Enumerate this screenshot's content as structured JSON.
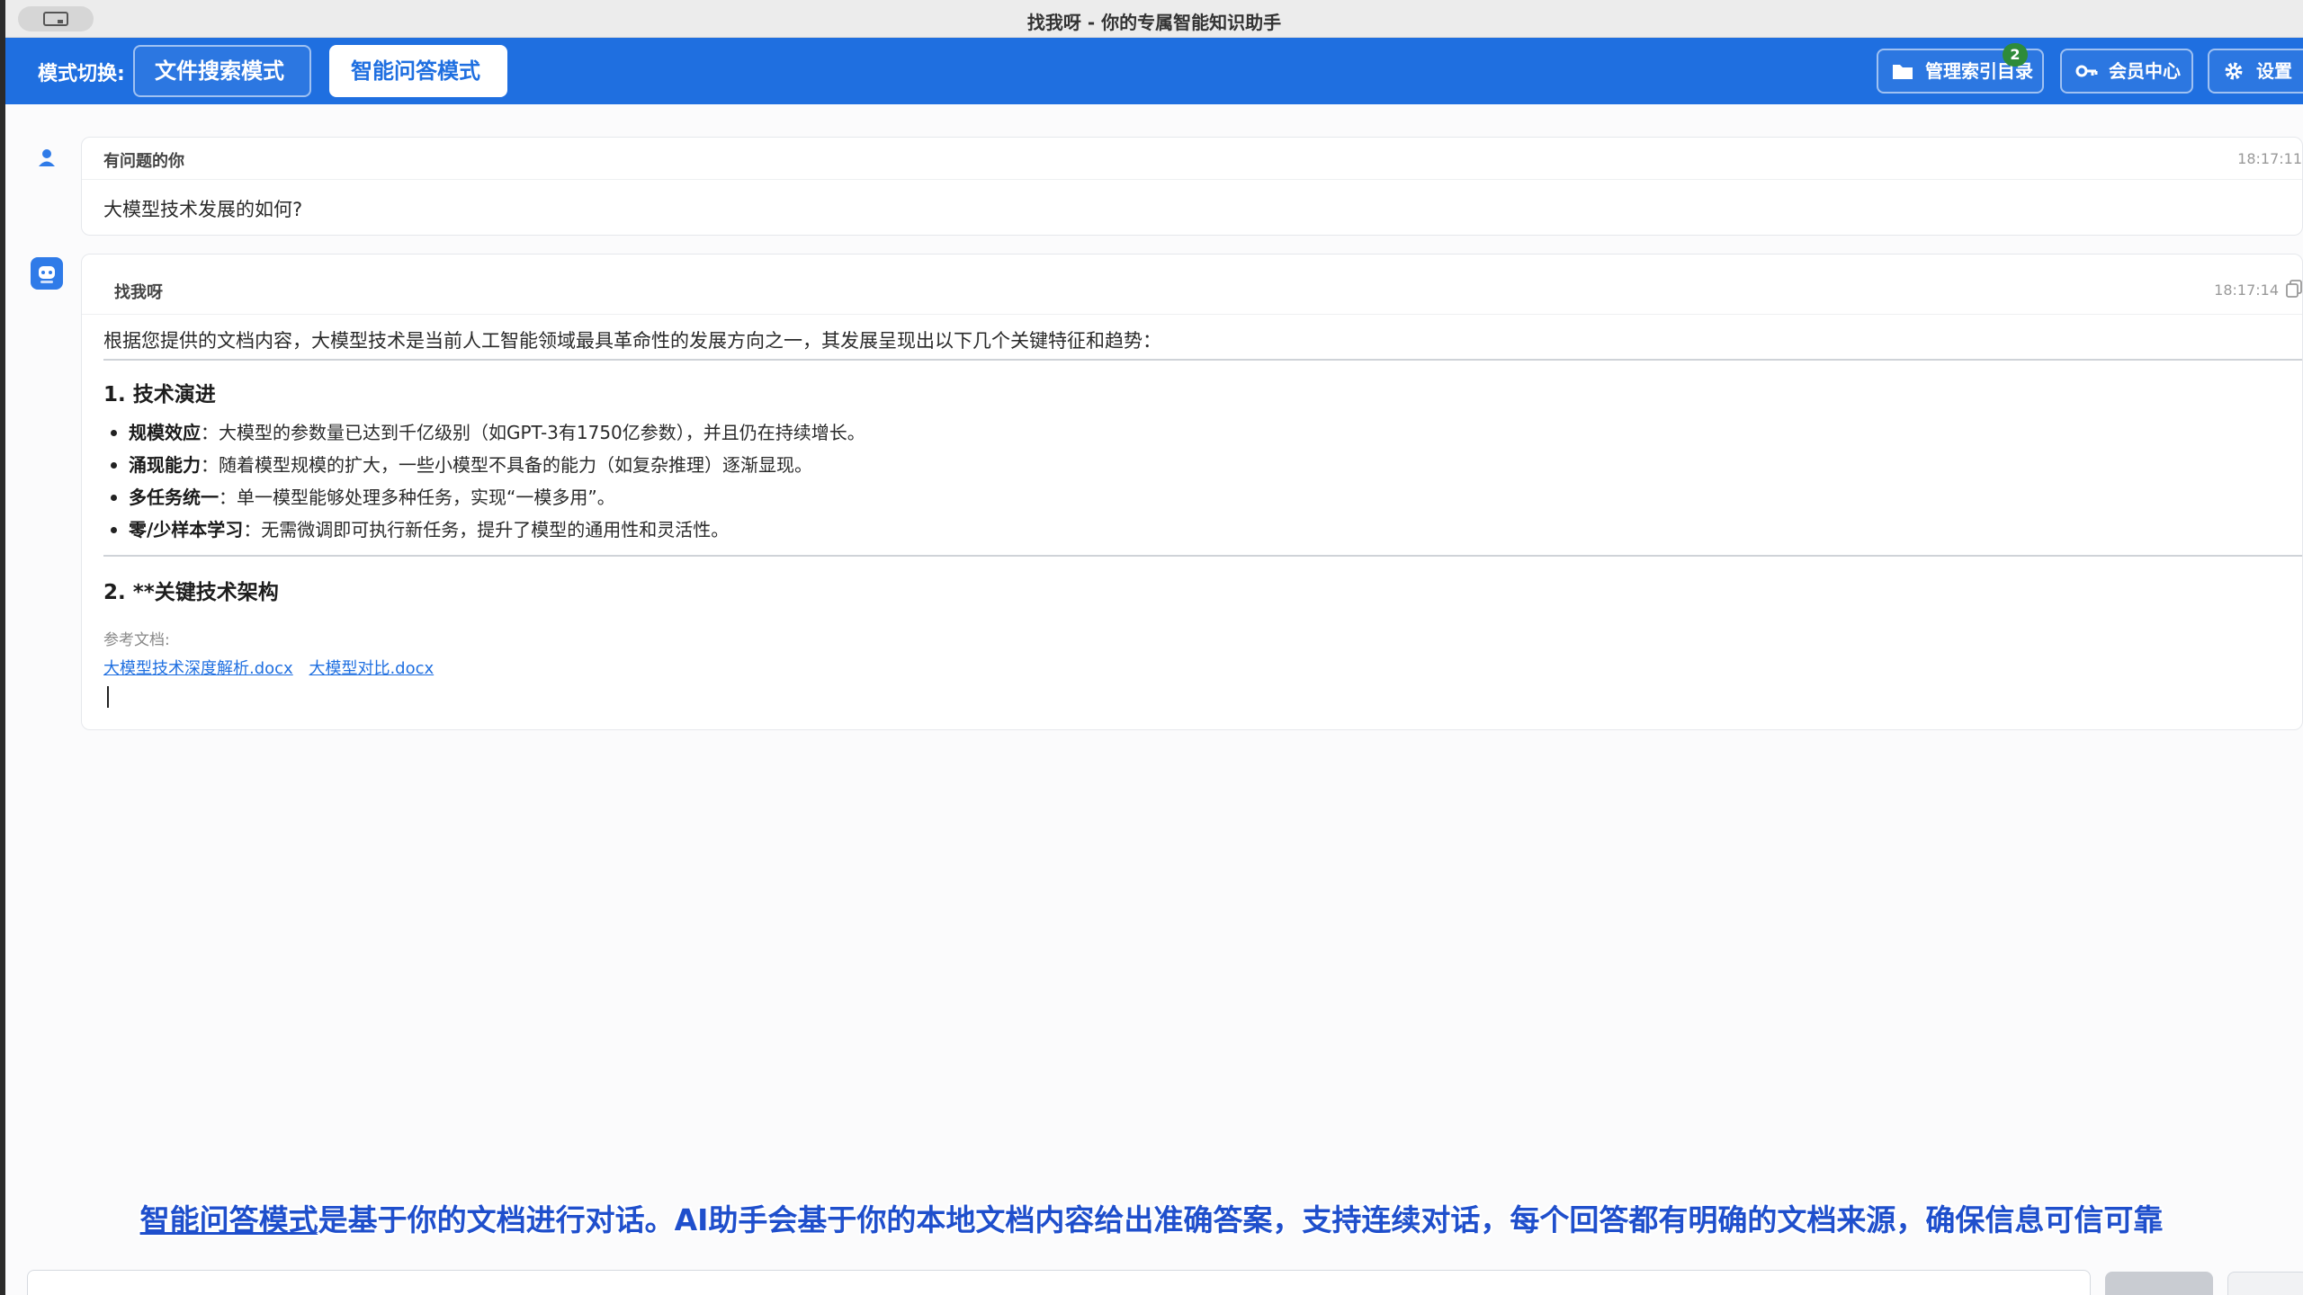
{
  "window": {
    "title": "找我呀 - 你的专属智能知识助手"
  },
  "toolbar": {
    "mode_label": "模式切换:",
    "file_search_mode": "文件搜索模式",
    "qa_mode": "智能问答模式",
    "manage_index": "管理索引目录",
    "manage_index_badge": "2",
    "member_center": "会员中心",
    "settings": "设置"
  },
  "chat": {
    "question": {
      "sender": "有问题的你",
      "time": "18:17:11",
      "text": "大模型技术发展的如何?"
    },
    "answer": {
      "sender": "找我呀",
      "time": "18:17:14",
      "intro": "根据您提供的文档内容，大模型技术是当前人工智能领域最具革命性的发展方向之一，其发展呈现出以下几个关键特征和趋势：",
      "section1_title": "1. 技术演进",
      "bullets": [
        {
          "term": "规模效应",
          "text": "：大模型的参数量已达到千亿级别（如GPT-3有1750亿参数），并且仍在持续增长。"
        },
        {
          "term": "涌现能力",
          "text": "：随着模型规模的扩大，一些小模型不具备的能力（如复杂推理）逐渐显现。"
        },
        {
          "term": "多任务统一",
          "text": "：单一模型能够处理多种任务，实现“一模多用”。"
        },
        {
          "term": "零/少样本学习",
          "text": "：无需微调即可执行新任务，提升了模型的通用性和灵活性。"
        }
      ],
      "section2_title": "2. **关键技术架构",
      "ref_label": "参考文档:",
      "refs": [
        "大模型技术深度解析.docx",
        "大模型对比.docx"
      ]
    }
  },
  "caption": {
    "highlight": "智能问答模式",
    "text": "是基于你的文档进行对话。AI助手会基于你的本地文档内容给出准确答案，支持连续对话，每个回答都有明确的文档来源，确保信息可信可靠"
  },
  "colors": {
    "toolbar_blue": "#1f6fe0",
    "badge_green": "#2e8b3a",
    "link_blue": "#1f6fe0"
  }
}
